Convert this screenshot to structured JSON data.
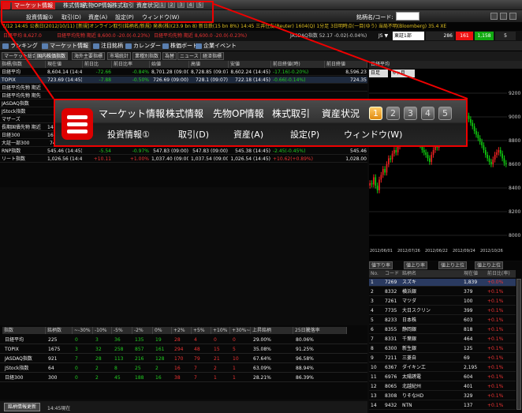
{
  "menu": {
    "top_items": [
      "マーケット情報",
      "株式情報",
      "先物OP情報",
      "株式取引",
      "資産状況"
    ],
    "sub_items": [
      "投資情報①",
      "取引(D)",
      "資産(A)",
      "設定(P)",
      "ウィンドウ(W)"
    ],
    "page_buttons": [
      "1",
      "2",
      "3",
      "4",
      "5"
    ],
    "code_label": "銘柄名/コード:"
  },
  "ticker": {
    "line1": "7/12 14:45 公表日(2012/10/11) [新規]オンライン取引(銘柄名/新規) 発表(株)(23.9 bn 8) 新日鉄(15 bn 8%)  14:45 三井住友(Reuter) 1604(Q) 1分足 3日明時点(一目(ゆう) 当局不明(Bloomberg) 35.4 XE",
    "seg_a": "日経平均 8,627.0",
    "seg_b": "日経平均先物 期近 8,600.0  -20.0(-0.23%)",
    "seg_c": "日経平均先物 期近 8,600.0  -20.0(-0.23%)",
    "seg_d": "JASDAQ指数 52.17  -0.02(-0.04%)",
    "seg_e": "JS  ▼",
    "selector": "東証1部",
    "box_1": "286",
    "box_2": "161",
    "box_3": "1,158",
    "box_4": "5"
  },
  "toolbar": [
    "ランキング",
    "マーケット情報",
    "注目銘柄",
    "カレンダー",
    "株価ボード",
    "企業イベント"
  ],
  "tabs": [
    "マーケット総合",
    "国内株価指数",
    "海外主要指標",
    "市場統計",
    "業種別指数",
    "為替",
    "ニュース",
    "経済指標"
  ],
  "main_table": {
    "headers": [
      "指標/指数",
      "現在値",
      "前日比",
      "前日比率",
      "始値",
      "高値",
      "安値",
      "前日終値(時)",
      "前日終値"
    ],
    "rows": [
      [
        "日経平均",
        "8,604.14 (14:45)",
        "-72.66",
        "-0.84%",
        "8,701.28 (09:00)",
        "8,728.85 (09:07)",
        "8,602.24 (14:45)",
        "-17.16(-0.20%)",
        "8,596.23"
      ],
      [
        "TOPIX",
        "723.69 (14:45)",
        "-7.88",
        "-0.50%",
        "726.69 (09:00)",
        "728.1 (09:07)",
        "722.18 (14:45)",
        "-0.66(-0.14%)",
        "724.35"
      ],
      [
        "日経平均先物 期近",
        "",
        "",
        "",
        "",
        "",
        "",
        "",
        ""
      ],
      [
        "日経平均先物 期先",
        "",
        "",
        "",
        "",
        "",
        "",
        "",
        ""
      ],
      [
        "JASDAQ指数",
        "",
        "",
        "",
        "",
        "",
        "",
        "",
        ""
      ],
      [
        "JStock指数",
        "",
        "",
        "",
        "",
        "",
        "",
        "",
        ""
      ],
      [
        "マザーズ",
        "",
        "",
        "",
        "",
        "",
        "",
        "",
        ""
      ],
      [
        "長期国債先物 期近",
        "144.56 (14:45)",
        "0",
        "0%",
        "144.56 (15:30)",
        "144.56 (15:30)",
        "144.52 (14:45)",
        "0.08(0.00%)",
        "144.56"
      ],
      [
        "日経300",
        "165.41 (14:45)",
        "-1.52",
        "-0.03%",
        "147.04 (09:00)",
        "147.06 (09:00)",
        "146.37 (14:45)",
        "-0.63(0.00%)",
        "145.41"
      ],
      [
        "大証一部300",
        "747.7 (14:45)",
        "-6.1",
        "-0.80%",
        "749.74 (09:00)",
        "749.81 (09:12)",
        "747.88 (14:33)",
        "-2.04(-0.27%)",
        "749.7"
      ],
      [
        "RNP指数",
        "545.46 (14:45)",
        "-5.54",
        "-0.97%",
        "547.83 (09:00)",
        "547.83 (09:00)",
        "545.38 (14:45)",
        "-2.45(-0.45%)",
        "545.46"
      ],
      [
        "リート指数",
        "1,026.56 (14:45)",
        "+10.11",
        "+1.00%",
        "1,037.40 (09:00)",
        "1,037.54 (09:00)",
        "1,026.54 (14:45)",
        "+10.62(+0.89%)",
        "1,028.00"
      ]
    ]
  },
  "stats_table": {
    "headers": [
      "指数",
      "銘柄数",
      "~-30%",
      "-10%",
      "-5%",
      "-2%",
      "0%",
      "+2%",
      "+5%",
      "+10%",
      "+30%~",
      "上昇銘柄",
      "25日騰落率"
    ],
    "rows": [
      [
        "日経平均",
        "225",
        "0",
        "3",
        "36",
        "135",
        "19",
        "28",
        "4",
        "0",
        "0",
        "29.00%",
        "80.06%"
      ],
      [
        "TOPIX",
        "1675",
        "3",
        "32",
        "258",
        "857",
        "161",
        "294",
        "48",
        "15",
        "5",
        "35.08%",
        "91.25%"
      ],
      [
        "JASDAQ指数",
        "921",
        "7",
        "28",
        "113",
        "216",
        "128",
        "170",
        "79",
        "21",
        "10",
        "67.64%",
        "96.58%"
      ],
      [
        "JStock指数",
        "64",
        "0",
        "2",
        "8",
        "25",
        "2",
        "16",
        "7",
        "2",
        "1",
        "63.09%",
        "88.94%"
      ],
      [
        "日経300",
        "300",
        "0",
        "2",
        "45",
        "188",
        "16",
        "38",
        "7",
        "1",
        "1",
        "28.21%",
        "86.39%"
      ]
    ],
    "update_button": "銘柄情報更新",
    "update_time": "14:45現在"
  },
  "chart_data": {
    "type": "candlestick",
    "header": "日経平均",
    "period": "日足",
    "span": "6ヶ月",
    "x": [
      "2012/06/01",
      "2012/07/26",
      "2012/06/22",
      "2012/09/24",
      "2012/10/26"
    ],
    "y_ticks": [
      9200,
      9000,
      8800,
      8600,
      8400,
      8200,
      8000
    ],
    "ylim": [
      7900,
      9300
    ],
    "close": [
      8440,
      8430,
      8490,
      8420,
      8380,
      8470,
      8510,
      8560,
      8530,
      8600,
      8650,
      8640,
      8690,
      8720,
      8700,
      8750,
      8800,
      8780,
      8840,
      8870,
      8830,
      8900,
      8950,
      8930,
      8880,
      8850,
      8800,
      8760,
      8720,
      8700,
      8680,
      8650,
      8620,
      8680,
      8720,
      8760,
      8740,
      8780,
      8820,
      8860,
      8900,
      8920,
      8870,
      8830,
      8800,
      8780,
      8820,
      8860,
      8890,
      8920,
      8950,
      8990,
      9010,
      8980,
      8950,
      8920,
      8880,
      8850,
      8820,
      8790,
      8760,
      8720,
      8680,
      8650,
      8620,
      8600,
      8640,
      8680,
      8700,
      8720,
      8690,
      8650,
      8610,
      8600
    ]
  },
  "ranking": {
    "tabs": [
      "値下り率",
      "値上り率",
      "値上り上位",
      "値上り上位"
    ],
    "headers": [
      "No.",
      "コード",
      "銘柄名",
      "現在値",
      "前日比(率)"
    ],
    "rows": [
      [
        "1",
        "7269",
        "スズキ",
        "1,839",
        "+0.0%"
      ],
      [
        "2",
        "8332",
        "横浜銀",
        "379",
        "+0.1%"
      ],
      [
        "3",
        "7261",
        "マツダ",
        "100",
        "+0.1%"
      ],
      [
        "4",
        "7735",
        "大日スクリン",
        "399",
        "+0.1%"
      ],
      [
        "5",
        "8233",
        "日本株",
        "603",
        "+0.1%"
      ],
      [
        "6",
        "8355",
        "静岡銀",
        "818",
        "+0.1%"
      ],
      [
        "7",
        "8331",
        "千葉銀",
        "464",
        "+0.1%"
      ],
      [
        "8",
        "6300",
        "新生銀",
        "125",
        "+0.1%"
      ],
      [
        "9",
        "7211",
        "三菱自",
        "69",
        "+0.1%"
      ],
      [
        "10",
        "6367",
        "ダイキン工",
        "2,195",
        "+0.1%"
      ],
      [
        "11",
        "6976",
        "太陽誘電",
        "604",
        "+0.1%"
      ],
      [
        "12",
        "8065",
        "北越紀州",
        "401",
        "+0.1%"
      ],
      [
        "13",
        "8308",
        "りそなHD",
        "329",
        "+0.1%"
      ],
      [
        "14",
        "9432",
        "NTN",
        "137",
        "+0.1%"
      ]
    ]
  }
}
